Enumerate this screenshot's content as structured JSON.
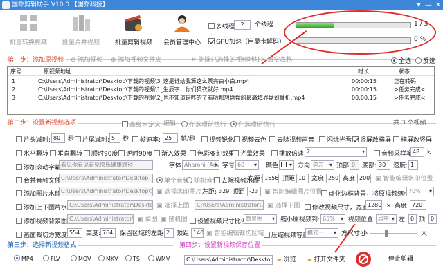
{
  "window": {
    "title": "国乔剪辑助手 V10.0 【国乔科技】",
    "controls": [
      "▾",
      "—",
      "✕"
    ]
  },
  "toolbar": {
    "buttons": [
      {
        "label": "批量转换视频",
        "icon": "grid-convert-icon"
      },
      {
        "label": "批量合并视频",
        "icon": "building-merge-icon"
      },
      {
        "label": "批量剪辑视频",
        "icon": "film-clapper-icon"
      },
      {
        "label": "会员管理中心",
        "icon": "member-avatar-icon"
      }
    ],
    "multithread_label": "多线程",
    "thread_count": "2",
    "thread_unit": "个线程",
    "gpu_label": "GPU加速（用显卡解码）"
  },
  "progress": {
    "bar1_text": "1 / 3",
    "bar1_fraction": 0.33,
    "bar2_text": "0 %",
    "bar2_fraction": 0.0
  },
  "step1": {
    "title": "第一步：添加原视频",
    "add_video": "添加视频",
    "add_folder": "添加视频文件夹",
    "delete_selected": "删除已选择的视频地址",
    "clear_table": "清空表格",
    "select_all": "全选",
    "invert": "反选"
  },
  "table": {
    "headers": [
      "序号",
      "原视频地址",
      "时长",
      "状态"
    ],
    "rows": [
      {
        "no": "1",
        "path": "C:\\Users\\Administrator\\Desktop\\下载的视频\\3_这是谁给我算这么票亮白小白.mp4",
        "duration": "00:00:15",
        "status": "正在转码"
      },
      {
        "no": "2",
        "path": "C:\\Users\\Administrator\\Desktop\\下载的视频\\1_生辰字，你们猜衣就好.mp4",
        "duration": "00:00:15",
        "status": ">任务完成<"
      },
      {
        "no": "3",
        "path": "C:\\Users\\Administrator\\Desktop\\下载的视频\\2_也不知道是咋的了看咕都想盘盘的最高填界盘到骨折.mp4",
        "duration": "00:00:15",
        "status": ">任务完成<"
      }
    ]
  },
  "step2": {
    "title": "第二步：设置新视频选项",
    "custom_label": "高级自定义",
    "edit_label": "编辑",
    "mode1": "在选项前执行",
    "mode2": "在选项后执行",
    "options_count": "共 3 个视频"
  },
  "opts": {
    "r1": {
      "head_cut": "片头减时:",
      "head_val": "80",
      "head_unit": "秒",
      "tail_cut": "片尾减时:",
      "tail_val": "5",
      "tail_unit": "秒",
      "fps_label": "帧速率:",
      "fps_val": "25",
      "fps_unit": "帧/秒",
      "sharpen": "视频锐化",
      "decolor": "视频去色",
      "mute": "去除视频声音",
      "flash": "闪烁光看",
      "vertical": "竖屏改横屏",
      "hscreen": "横屏改竖屏"
    },
    "r2": {
      "hflip": "水平翻转",
      "vflip": "垂直翻转",
      "cw90": "顺时90度",
      "ccw90": "逆时90度",
      "fade": "渐入效果",
      "color_var": "色彩变幻效果",
      "light": "光晕效果",
      "speed_label": "播放倍速:",
      "speed_val": "2",
      "sample_label": "音频采样率:",
      "sample_val": "48",
      "sample_unit": "k"
    },
    "r3": {
      "subtitle": "添加滚动字幕:",
      "subtitle_text": "看见你看见看见快乐健康路径",
      "font_label": "字体:",
      "font_val": "Aharoni (Adv",
      "size_label": "字号:",
      "size_val": "60",
      "color_label": "颜色:",
      "dir_label": "方向:",
      "dir_val": "向左",
      "top_label": "顶部:",
      "top_val": "0",
      "bottom_label": "底部:",
      "bottom_val": "30",
      "spd_label": "速度:",
      "spd_val": "1"
    },
    "r4": {
      "merge_audio": "合并音频文件:",
      "audio_path": "C:\\Users\\Administrator\\Desktop",
      "single_audio": "单个音频",
      "random_audio": "随机音频",
      "wm_label": "去除视频水印:",
      "left_label": "左距:",
      "left_val": "1656",
      "top_label": "顶距:",
      "top_val": "10",
      "w_label": "宽度:",
      "w_val": "250",
      "h_label": "高度:",
      "h_val": "200",
      "smart": "智能编辑水印位置"
    },
    "r5": {
      "add_pic": "添加图片水印:",
      "pic_path": "C:\\Users\\Administrator\\Desktop\\水印图片",
      "choose_pic": "选择水印图片",
      "left_label": "左距:",
      "left_val": "329",
      "top_label": "顶距:",
      "top_val": "-23",
      "smart_pos": "智能编辑图片位置",
      "blur_bg": "虚化边框背景，将原视频缩小到:",
      "blur_val": "70%"
    },
    "r6": {
      "add_topbot": "添加上下图片水印:",
      "topbot_path": "C:\\Users\\Administrator\\Desktop",
      "choose_top": "选择上图",
      "bottom_path": "C:\\Users\\Administrator\\Desk",
      "choose_bottom": "选择下图",
      "resize": "修改视频尺寸，宽度:",
      "rw_val": "1280",
      "times": "×",
      "rh_label": "高度:",
      "rh_val": "720"
    },
    "r7": {
      "add_bg": "添加视频背景图片:",
      "bg_path": "C:\\Users\\Administrator\\D",
      "single_pic": "单图",
      "random_pic": "随机图",
      "set_ratio": "设置视频尺寸比例:",
      "ratio_val": "背景图",
      "shrink_label": "缩小原视频到:",
      "shrink_val": "65%",
      "pos_label": "视频位置:",
      "pos_val": "居中",
      "left_label": "左:",
      "left_val": "0",
      "top_label": "顶:",
      "top_val": "0"
    },
    "r8": {
      "crop": "画面裁切方宽度:",
      "crop_w": "554",
      "crop_h_label": "高度:",
      "crop_h": "764",
      "keep_left": "保留区域的左距:",
      "keep_left_val": "2",
      "keep_top_label": "顶距:",
      "keep_top_val": "140",
      "smart_crop": "智能编辑裁切区域",
      "compress": "压缩视频容量",
      "compress_mode": "模式一",
      "size_label": "方尺寸小",
      "small": "小",
      "big": "大",
      "compress_fraction": 0.35
    }
  },
  "step3": {
    "title": "第三步：选择新视频格式",
    "formats": [
      "MP4",
      "FLV",
      "MOV",
      "MKV",
      "TS",
      "WMV"
    ],
    "selected": "MP4"
  },
  "step4": {
    "title": "第四步：设置新视频保存位置",
    "save_path": "C:\\Users\\Administrator\\Desktop\\下",
    "browse": "浏览",
    "open_folder": "打开文件夹",
    "stop": "停止剪辑"
  },
  "colors": {
    "step_red": "#e0462a",
    "step_blue": "#1a5fb4",
    "step_pink": "#d63cc8",
    "annotation_red": "#e02b2b",
    "title_blue": "#3e86d8"
  }
}
